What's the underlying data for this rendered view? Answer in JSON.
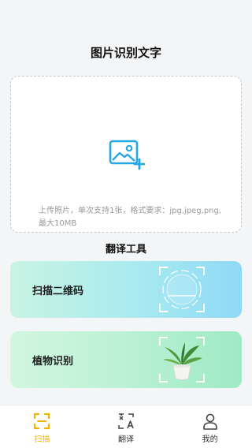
{
  "header": {
    "title": "图片识别文字"
  },
  "upload": {
    "icon": "image-add-icon",
    "hint": "上传照片，单次支持1张，格式要求：jpg,jpeg,png,最大10MB"
  },
  "tools": {
    "title": "翻译工具",
    "items": [
      {
        "label": "扫描二维码",
        "icon": "qr-scan-frame-icon"
      },
      {
        "label": "植物识别",
        "icon": "potted-plant-icon"
      }
    ]
  },
  "tabbar": {
    "items": [
      {
        "label": "扫描",
        "icon": "scan-icon",
        "active": true
      },
      {
        "label": "翻译",
        "icon": "translate-icon",
        "active": false
      },
      {
        "label": "我的",
        "icon": "user-icon",
        "active": false
      }
    ]
  },
  "colors": {
    "accent": "#f3b400",
    "upload_icon": "#27a8e6",
    "qr_card_gradient": [
      "#c8f4e2",
      "#8fd9f6"
    ],
    "plant_card_gradient": [
      "#d2f6df",
      "#9eeac4"
    ]
  }
}
